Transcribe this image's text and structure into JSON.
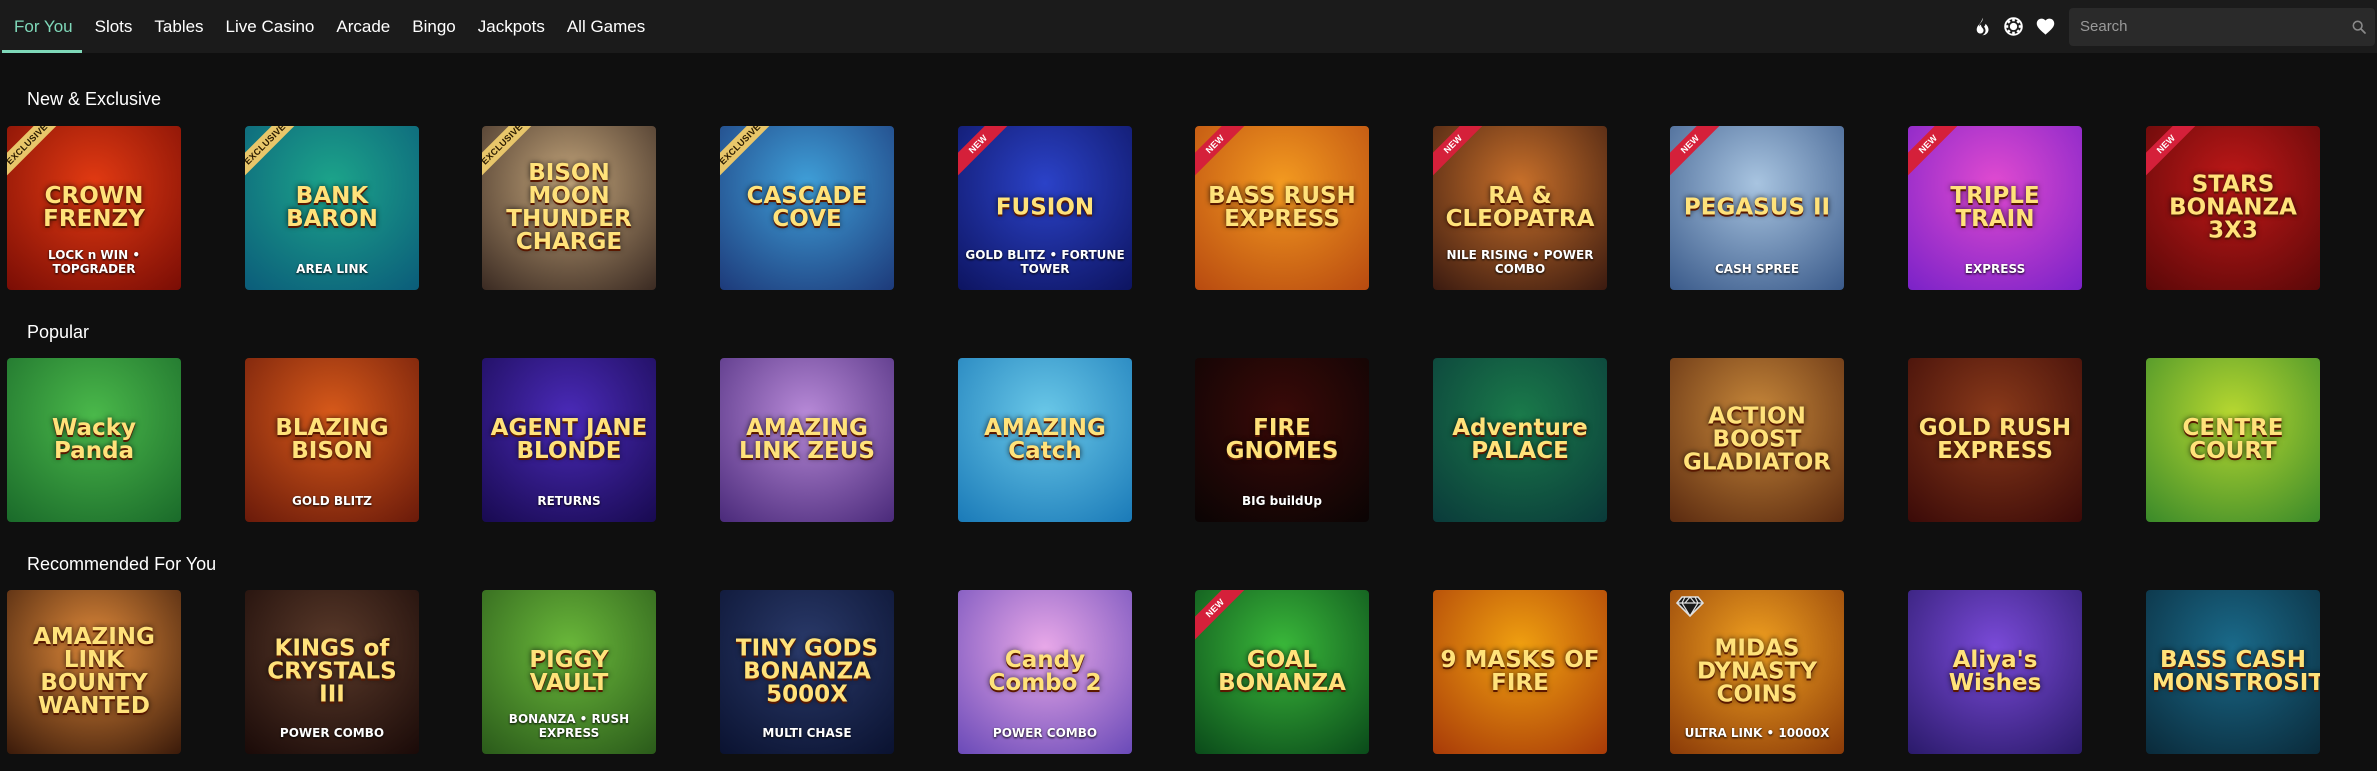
{
  "nav": {
    "tabs": [
      "For You",
      "Slots",
      "Tables",
      "Live Casino",
      "Arcade",
      "Bingo",
      "Jackpots",
      "All Games"
    ],
    "active_index": 0
  },
  "toolbar": {
    "icons": [
      "flame-icon",
      "chip-icon",
      "heart-icon"
    ],
    "search_placeholder": "Search"
  },
  "colors": {
    "accent": "#7fd8b9",
    "background": "#0f0f0f",
    "topbar": "#1b1b1b",
    "new_ribbon": "#d5203a",
    "exclusive_ribbon": "#e8c66a"
  },
  "sections": [
    {
      "title": "New & Exclusive",
      "games": [
        {
          "name": "CROWN FRENZY",
          "sub": "LOCK n WIN • TOPGRADER",
          "badge": "EXCLUSIVE",
          "bg": [
            "#e23a12",
            "#7a0d05"
          ]
        },
        {
          "name": "BANK BARON",
          "sub": "AREA LINK",
          "badge": "EXCLUSIVE",
          "bg": [
            "#1ca48a",
            "#0b5c7a"
          ]
        },
        {
          "name": "BISON MOON THUNDER CHARGE",
          "sub": "",
          "badge": "EXCLUSIVE",
          "bg": [
            "#c2a47a",
            "#3a2a22"
          ]
        },
        {
          "name": "CASCADE COVE",
          "sub": "",
          "badge": "EXCLUSIVE",
          "bg": [
            "#3f9fd8",
            "#1d3a7a"
          ]
        },
        {
          "name": "FUSION",
          "sub": "GOLD BLITZ • FORTUNE TOWER",
          "badge": "NEW",
          "bg": [
            "#2b42c8",
            "#0d1460"
          ]
        },
        {
          "name": "BASS RUSH EXPRESS",
          "sub": "",
          "badge": "NEW",
          "bg": [
            "#f39a20",
            "#b84a10"
          ]
        },
        {
          "name": "RA & CLEOPATRA",
          "sub": "NILE RISING • POWER COMBO",
          "badge": "NEW",
          "bg": [
            "#c8702a",
            "#3a1a10"
          ]
        },
        {
          "name": "PEGASUS II",
          "sub": "CASH SPREE",
          "badge": "NEW",
          "bg": [
            "#a8c4e0",
            "#3a5a8a"
          ]
        },
        {
          "name": "TRIPLE TRAIN",
          "sub": "EXPRESS",
          "badge": "NEW",
          "bg": [
            "#e04ad0",
            "#7a22c8"
          ]
        },
        {
          "name": "STARS BONANZA 3X3",
          "sub": "",
          "badge": "NEW",
          "bg": [
            "#c01818",
            "#5a0808"
          ]
        }
      ]
    },
    {
      "title": "Popular",
      "games": [
        {
          "name": "Wacky Panda",
          "sub": "",
          "badge": "",
          "bg": [
            "#4ab84a",
            "#1a6a2a"
          ]
        },
        {
          "name": "BLAZING BISON",
          "sub": "GOLD BLITZ",
          "badge": "",
          "bg": [
            "#d85a1a",
            "#6a1a0a"
          ]
        },
        {
          "name": "AGENT JANE BLONDE",
          "sub": "RETURNS",
          "badge": "",
          "bg": [
            "#4a2ab8",
            "#180a50"
          ]
        },
        {
          "name": "AMAZING LINK ZEUS",
          "sub": "",
          "badge": "",
          "bg": [
            "#b88ad8",
            "#4a2a7a"
          ]
        },
        {
          "name": "AMAZING Catch",
          "sub": "",
          "badge": "",
          "bg": [
            "#6ac8e8",
            "#1a7ab8"
          ]
        },
        {
          "name": "FIRE GNOMES",
          "sub": "BIG buildUp",
          "badge": "",
          "bg": [
            "#3a0a08",
            "#0a0404"
          ]
        },
        {
          "name": "Adventure PALACE",
          "sub": "",
          "badge": "",
          "bg": [
            "#1a7a4a",
            "#0a3a3a"
          ]
        },
        {
          "name": "ACTION BOOST GLADIATOR",
          "sub": "",
          "badge": "",
          "bg": [
            "#c8883a",
            "#5a2a10"
          ]
        },
        {
          "name": "GOLD RUSH EXPRESS",
          "sub": "",
          "badge": "",
          "bg": [
            "#8a3a1a",
            "#3a0a08"
          ]
        },
        {
          "name": "CENTRE COURT",
          "sub": "",
          "badge": "",
          "bg": [
            "#b8d830",
            "#3a8a2a"
          ]
        }
      ]
    },
    {
      "title": "Recommended For You",
      "games": [
        {
          "name": "AMAZING LINK BOUNTY WANTED",
          "sub": "",
          "badge": "",
          "bg": [
            "#e08a3a",
            "#3a1a0a"
          ]
        },
        {
          "name": "KINGS of CRYSTALS III",
          "sub": "POWER COMBO",
          "badge": "",
          "bg": [
            "#5a3a2a",
            "#1a0a08"
          ]
        },
        {
          "name": "PIGGY VAULT",
          "sub": "BONANZA • RUSH EXPRESS",
          "badge": "",
          "bg": [
            "#6ab83a",
            "#2a5a1a"
          ]
        },
        {
          "name": "TINY GODS BONANZA 5000X",
          "sub": "MULTI CHASE",
          "badge": "",
          "bg": [
            "#2a3a6a",
            "#0a1230"
          ]
        },
        {
          "name": "Candy Combo 2",
          "sub": "POWER COMBO",
          "badge": "",
          "bg": [
            "#e8a8e8",
            "#6a4ab8"
          ]
        },
        {
          "name": "GOAL BONANZA",
          "sub": "",
          "badge": "NEW",
          "bg": [
            "#3ab83a",
            "#0a4a1a"
          ]
        },
        {
          "name": "9 MASKS OF FIRE",
          "sub": "",
          "badge": "",
          "bg": [
            "#f0a010",
            "#a83a08"
          ]
        },
        {
          "name": "MIDAS DYNASTY COINS",
          "sub": "ULTRA LINK • 10000X",
          "badge": "diamond",
          "bg": [
            "#f0a020",
            "#8a3a08"
          ]
        },
        {
          "name": "Aliya's Wishes",
          "sub": "",
          "badge": "",
          "bg": [
            "#7a4ad8",
            "#2a1a6a"
          ]
        },
        {
          "name": "BASS CASH MONSTROSITY",
          "sub": "",
          "badge": "",
          "bg": [
            "#1a6a8a",
            "#0a2a3a"
          ]
        }
      ]
    }
  ]
}
